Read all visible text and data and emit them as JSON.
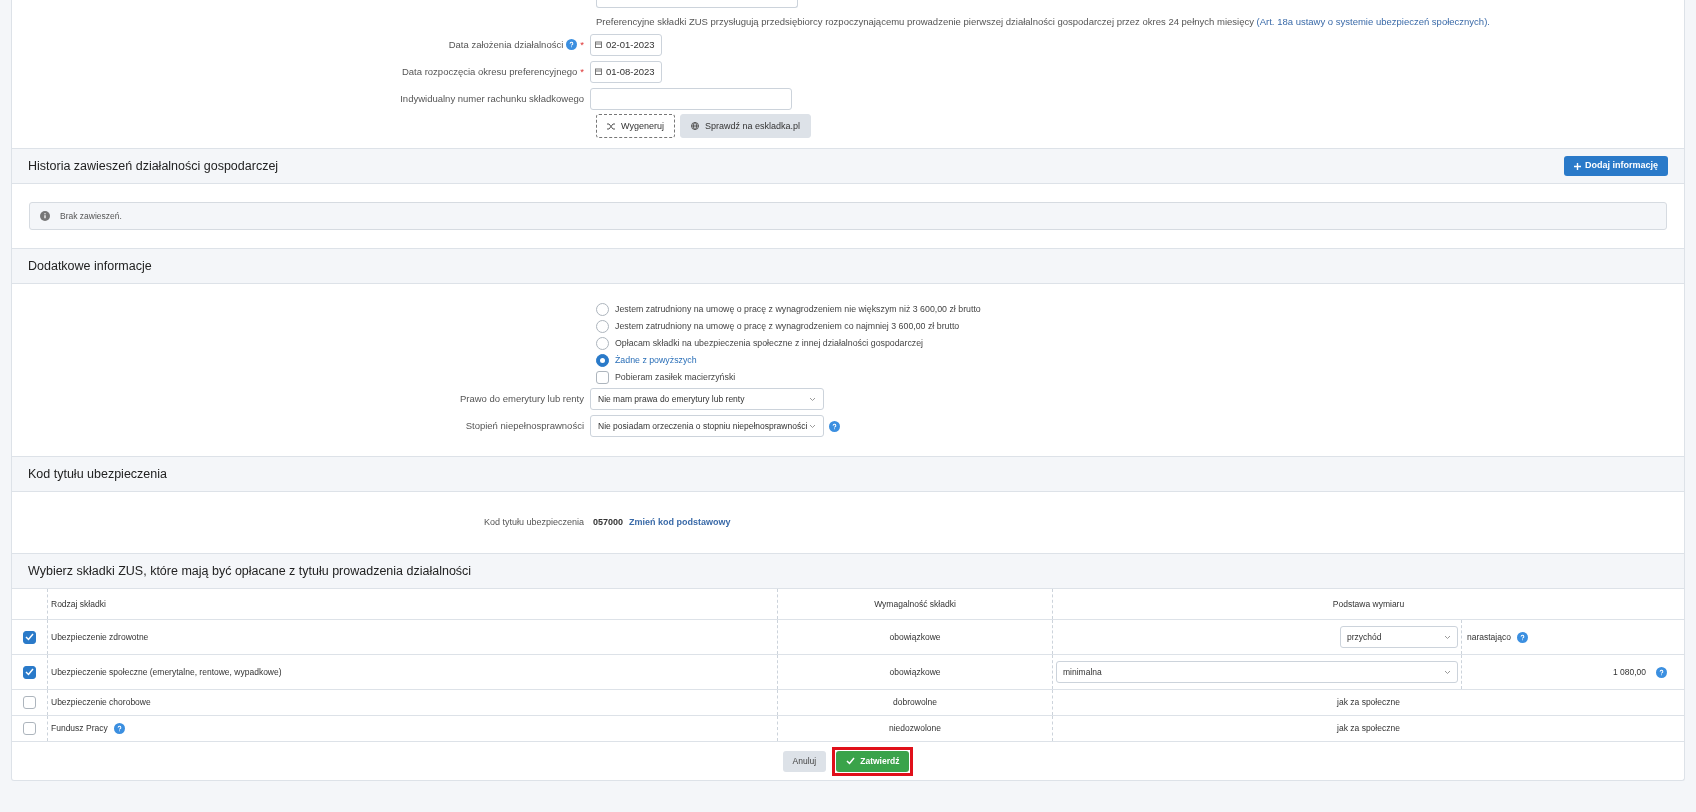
{
  "preferences": {
    "note": "Preferencyjne składki ZUS przysługują przedsiębiorcy rozpoczynającemu prowadzenie pierwszej działalności gospodarczej przez okres 24 pełnych miesięcy",
    "note_link": "(Art. 18a ustawy o systemie ubezpieczeń społecznych).",
    "fields": [
      {
        "kind": "date",
        "label": "Data założenia działalności",
        "help": true,
        "required_mark": "*",
        "value": "02-01-2023"
      },
      {
        "kind": "date",
        "label": "Data rozpoczęcia okresu preferencyjnego",
        "help": false,
        "required_mark": "*",
        "value": "01-08-2023"
      },
      {
        "kind": "text",
        "label": "Indywidualny numer rachunku składkowego",
        "help": false
      }
    ],
    "buttons": [
      {
        "kind": "dashed",
        "label": "Wygeneruj"
      },
      {
        "kind": "filled",
        "label": "Sprawdź na eskladka.pl"
      }
    ]
  },
  "history": {
    "title": "Historia zawieszeń działalności gospodarczej",
    "button": "Dodaj informację",
    "info": "Brak zawieszeń."
  },
  "additional": {
    "title": "Dodatkowe informacje",
    "options": [
      {
        "kind": "radio",
        "label": "Jestem zatrudniony na umowę o pracę z wynagrodzeniem nie większym niż 3 600,00 zł brutto",
        "selected": false
      },
      {
        "kind": "radio",
        "label": "Jestem zatrudniony na umowę o pracę z wynagrodzeniem co najmniej 3 600,00 zł brutto",
        "selected": false
      },
      {
        "kind": "radio",
        "label": "Opłacam składki na ubezpieczenia społeczne z innej działalności gospodarczej",
        "selected": false
      },
      {
        "kind": "radio",
        "label": "Żadne z powyższych",
        "selected": true
      },
      {
        "kind": "checkbox",
        "label": "Pobieram zasiłek macierzyński",
        "checked": false
      }
    ],
    "selects": [
      {
        "label": "Prawo do emerytury lub renty",
        "value": "Nie mam prawa do emerytury lub renty",
        "help": false
      },
      {
        "label": "Stopień niepełnosprawności",
        "value": "Nie posiadam orzeczenia o stopniu niepełnosprawności",
        "help": true
      }
    ]
  },
  "insurance_code": {
    "title": "Kod tytułu ubezpieczenia",
    "label": "Kod tytułu ubezpieczenia",
    "code": "057000",
    "link": "Zmień kod podstawowy"
  },
  "contributions": {
    "title": "Wybierz składki ZUS, które mają być opłacane z tytułu prowadzenia działalności",
    "columns": [
      "Rodzaj składki",
      "Wymagalność składki",
      "Podstawa wymiaru"
    ],
    "rows": [
      {
        "checked": true,
        "name": "Ubezpieczenie zdrowotne",
        "help": false,
        "requirement": "obowiązkowe",
        "basis": {
          "kind": "select-side",
          "value": "przychód",
          "extra": "narastająco",
          "help": true
        }
      },
      {
        "checked": true,
        "name": "Ubezpieczenie społeczne (emerytalne, rentowe, wypadkowe)",
        "help": false,
        "requirement": "obowiązkowe",
        "basis": {
          "kind": "select-wide",
          "value": "minimalna",
          "extra": "1 080,00",
          "help": true
        }
      },
      {
        "checked": false,
        "name": "Ubezpieczenie chorobowe",
        "help": false,
        "requirement": "dobrowolne",
        "basis": {
          "kind": "text",
          "value": "jak za społeczne"
        }
      },
      {
        "checked": false,
        "name": "Fundusz Pracy",
        "help": true,
        "requirement": "niedozwolone",
        "basis": {
          "kind": "text",
          "value": "jak za społeczne"
        }
      }
    ]
  },
  "footer": {
    "buttons": [
      {
        "kind": "cancel",
        "label": "Anuluj",
        "highlighted": false
      },
      {
        "kind": "confirm",
        "label": "Zatwierdź",
        "highlighted": true
      }
    ]
  }
}
